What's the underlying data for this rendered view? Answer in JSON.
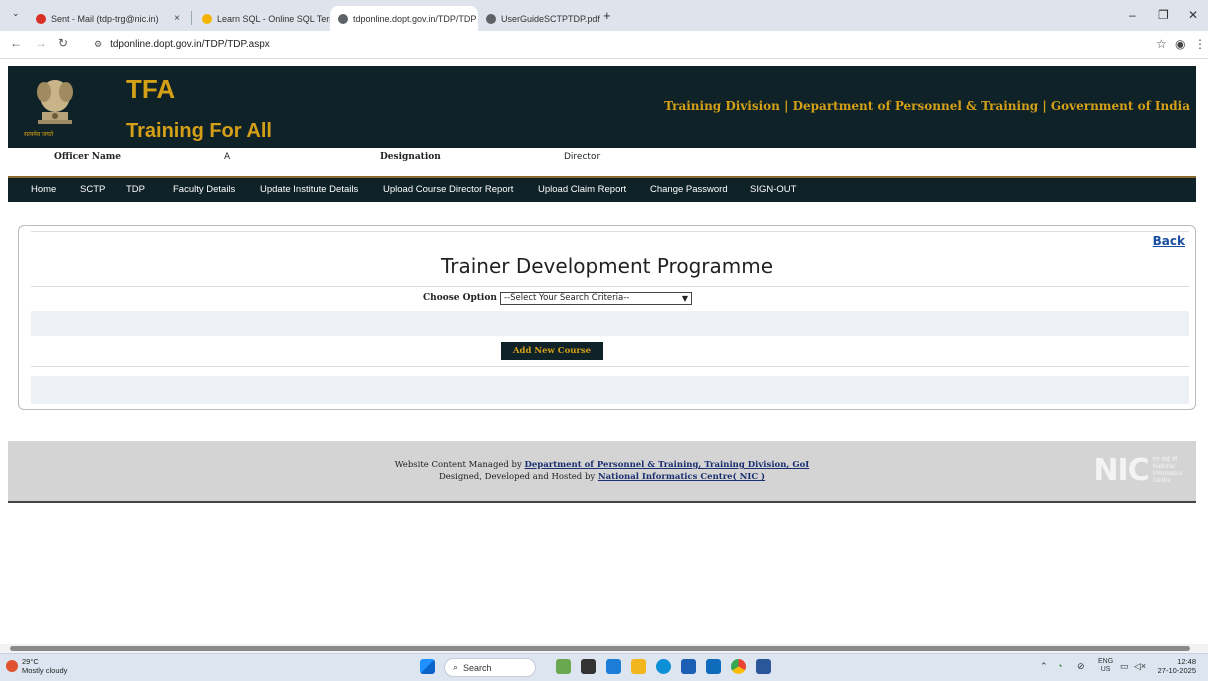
{
  "browser": {
    "tabs": [
      {
        "label": "Sent - Mail (tdp-trg@nic.in)",
        "color": "#d93025"
      },
      {
        "label": "Learn SQL - Online SQL Terminal",
        "color": "#f4b400"
      },
      {
        "label": "tdponline.dopt.gov.in/TDP/TDP",
        "color": "#5f6368"
      },
      {
        "label": "UserGuideSCTPTDP.pdf",
        "color": "#5f6368"
      }
    ],
    "url": "tdponline.dopt.gov.in/TDP/TDP.aspx"
  },
  "header": {
    "logo_text": "TFA",
    "subtitle": "Training For All",
    "tagline": "Training Division | Department of Personnel & Training | Government of India",
    "emblem_caption": "सत्यमेव जयते"
  },
  "officer": {
    "name_label": "Officer Name",
    "name_value": "A",
    "designation_label": "Designation",
    "designation_value": "Director"
  },
  "nav": {
    "items": [
      "Home",
      "SCTP",
      "TDP",
      "Faculty Details",
      "Update Institute Details",
      "Upload Course Director Report",
      "Upload Claim Report",
      "Change Password",
      "SIGN-OUT"
    ]
  },
  "main": {
    "back_label": "Back",
    "title": "Trainer Development Programme",
    "choose_label": "Choose Option",
    "select_value": "--Select Your Search Criteria--",
    "add_button": "Add New Course"
  },
  "footer": {
    "line1_prefix": "Website Content Managed by ",
    "line1_link": "Department of Personnel & Training, Training Division, GoI",
    "line2_prefix": "Designed, Developed and Hosted by ",
    "line2_link": "National Informatics Centre( NIC )",
    "nic_logo": "NIC",
    "nic_hindi": "एन आई सी",
    "nic_sub": [
      "National",
      "Informatics",
      "Centre"
    ]
  },
  "taskbar": {
    "temperature": "29°C",
    "weather": "Mostly cloudy",
    "search_placeholder": "Search",
    "lang": "ENG",
    "region": "US",
    "time": "12:48",
    "date": "27-10-2025"
  }
}
